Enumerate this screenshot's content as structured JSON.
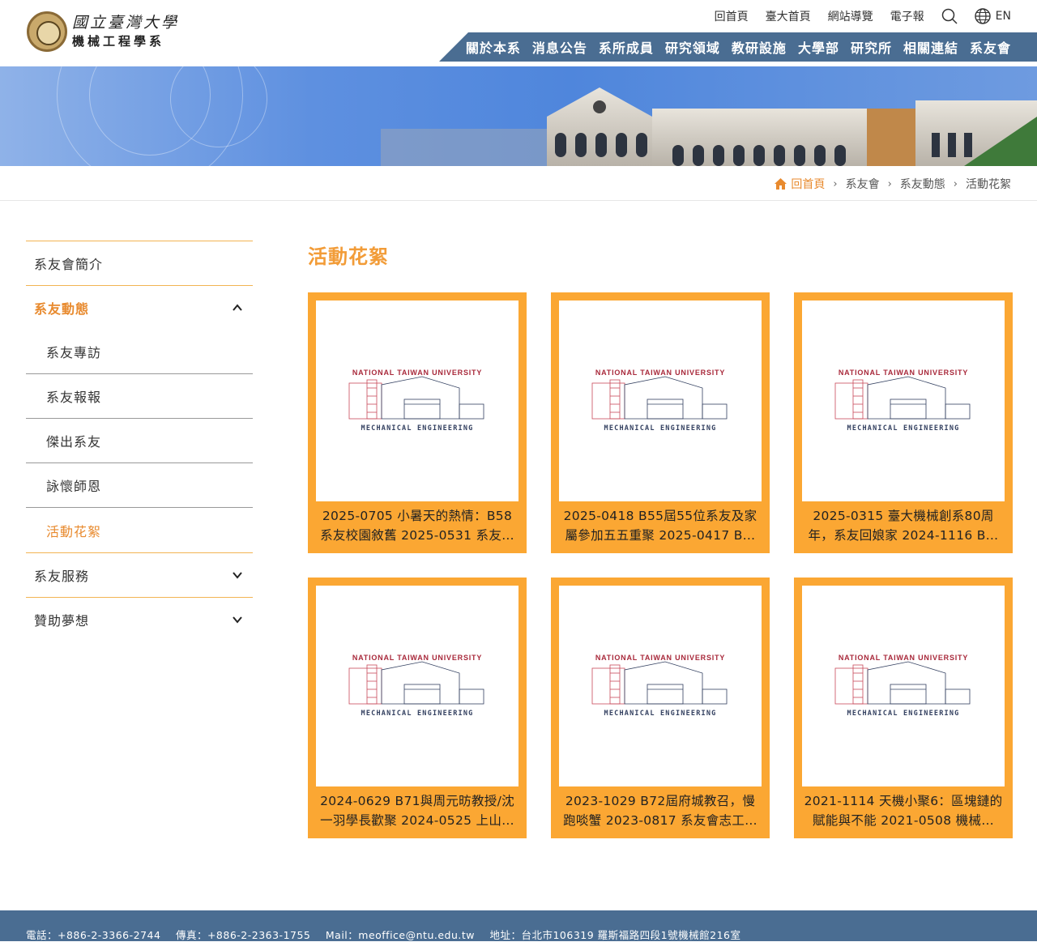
{
  "header": {
    "logo_line1": "國立臺灣大學",
    "logo_line2": "機械工程學系",
    "top_links": [
      "回首頁",
      "臺大首頁",
      "網站導覽",
      "電子報"
    ],
    "lang_label": "EN",
    "main_nav": [
      "關於本系",
      "消息公告",
      "系所成員",
      "研究領域",
      "教研設施",
      "大學部",
      "研究所",
      "相關連結",
      "系友會"
    ]
  },
  "breadcrumb": {
    "home": "回首頁",
    "items": [
      "系友會",
      "系友動態",
      "活動花絮"
    ]
  },
  "sidebar": {
    "items": [
      {
        "label": "系友會簡介"
      },
      {
        "label": "系友動態",
        "expanded": true,
        "children": [
          "系友專訪",
          "系友報報",
          "傑出系友",
          "詠懷師恩",
          "活動花絮"
        ]
      },
      {
        "label": "系友服務"
      },
      {
        "label": "贊助夢想"
      }
    ]
  },
  "main": {
    "title": "活動花絮",
    "image_text": {
      "top": "NATIONAL TAIWAN UNIVERSITY",
      "bottom": "MECHANICAL ENGINEERING"
    },
    "cards": [
      {
        "caption": "2025-0705 小暑天的熱情：B58系友校園敘舊 2025-0531 系友…"
      },
      {
        "caption": "2025-0418 B55屆55位系友及家屬參加五五重聚 2025-0417 B…"
      },
      {
        "caption": "2025-0315 臺大機械創系80周年，系友回娘家 2024-1116 B…"
      },
      {
        "caption": "2024-0629 B71與周元昉教授/沈一羽學長歡聚 2024-0525 上山…"
      },
      {
        "caption": "2023-1029 B72屆府城教召，慢跑啖蟹 2023-0817 系友會志工…"
      },
      {
        "caption": "2021-1114 天機小聚6：區塊鏈的賦能與不能 2021-0508 機械…"
      }
    ]
  },
  "footer": {
    "phone": "電話：+886-2-3366-2744",
    "fax": "傳真：+886-2-2363-1755",
    "mail": "Mail：meoffice@ntu.edu.tw",
    "address": "地址：台北市106319 羅斯福路四段1號機械館216室"
  },
  "colors": {
    "accent": "#f29c38",
    "nav": "#4a6d92",
    "card": "#fba733"
  }
}
